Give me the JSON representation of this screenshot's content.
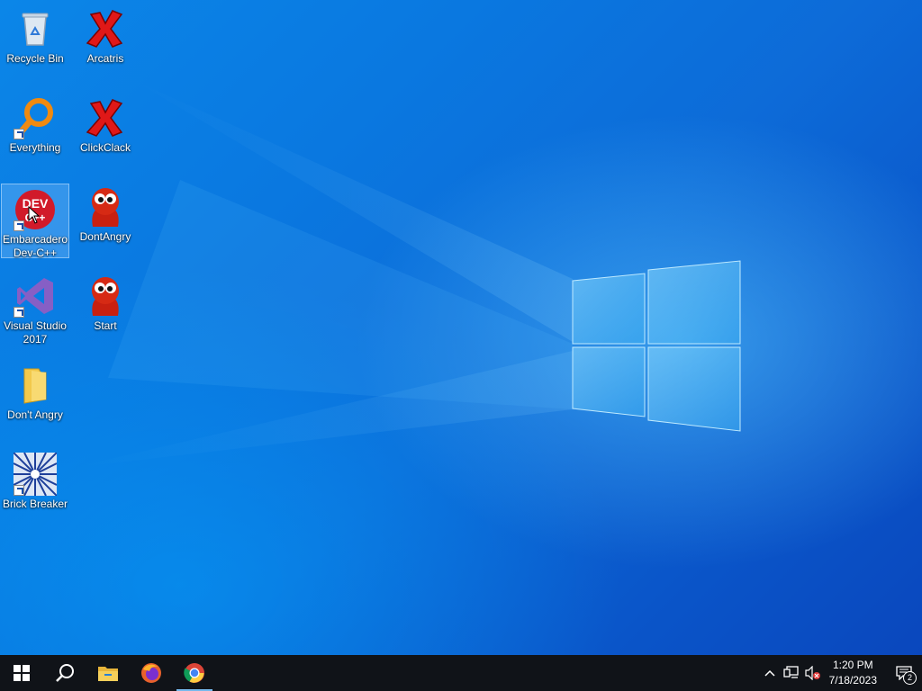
{
  "desktop": {
    "icons": [
      {
        "label": "Recycle Bin",
        "icon": "recycle-bin-icon"
      },
      {
        "label": "Arcatris",
        "icon": "red-x-icon"
      },
      {
        "label": "Everything",
        "icon": "magnifier-icon"
      },
      {
        "label": "ClickClack",
        "icon": "red-x-icon"
      },
      {
        "label": "Embarcadero Dev-C++",
        "icon": "devcpp-icon",
        "selected": true
      },
      {
        "label": "DontAngry",
        "icon": "red-creature-icon"
      },
      {
        "label": "Visual Studio 2017",
        "icon": "visual-studio-icon"
      },
      {
        "label": "Start",
        "icon": "red-creature-icon"
      },
      {
        "label": "Don't Angry",
        "icon": "folder-icon"
      },
      {
        "label": "Brick Breaker",
        "icon": "starburst-icon"
      }
    ]
  },
  "taskbar": {
    "pinned": [
      "start-icon",
      "search-icon",
      "file-explorer-icon",
      "firefox-icon",
      "chrome-icon"
    ],
    "active": "chrome-icon",
    "tray": {
      "time": "1:20 PM",
      "date": "7/18/2023",
      "notifications_count": "2"
    }
  },
  "colors": {
    "taskbar_bg": "#101318",
    "accent": "#76b9ed",
    "wallpaper_blue": "#0a78e0"
  }
}
